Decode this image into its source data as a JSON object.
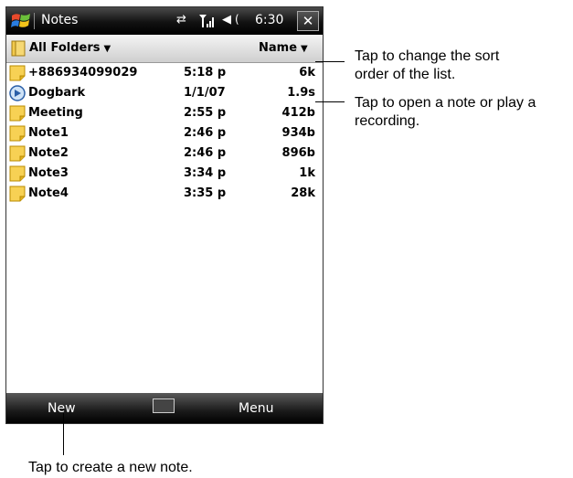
{
  "titlebar": {
    "app_title": "Notes",
    "clock": "6:30",
    "icons": [
      "windows-start-icon",
      "sync-icon",
      "signal-icon",
      "volume-icon",
      "close-icon"
    ]
  },
  "folderbar": {
    "folder_label": "All Folders",
    "sort_label": "Name"
  },
  "notes": [
    {
      "name": "+886934099029",
      "time": "5:18 p",
      "size": "6k",
      "icon": "note-icon"
    },
    {
      "name": "Dogbark",
      "time": "1/1/07",
      "size": "1.9s",
      "icon": "recording-icon"
    },
    {
      "name": "Meeting",
      "time": "2:55 p",
      "size": "412b",
      "icon": "note-icon"
    },
    {
      "name": "Note1",
      "time": "2:46 p",
      "size": "934b",
      "icon": "note-icon"
    },
    {
      "name": "Note2",
      "time": "2:46 p",
      "size": "896b",
      "icon": "note-icon"
    },
    {
      "name": "Note3",
      "time": "3:34 p",
      "size": "1k",
      "icon": "note-icon"
    },
    {
      "name": "Note4",
      "time": "3:35 p",
      "size": "28k",
      "icon": "note-icon"
    }
  ],
  "menubar": {
    "left_softkey": "New",
    "right_softkey": "Menu"
  },
  "callouts": {
    "sort_line1": "Tap to change the sort",
    "sort_line2": "order of the list.",
    "open_line1": "Tap to open a note or play a",
    "open_line2": "recording.",
    "new_note": "Tap to create a new note."
  }
}
